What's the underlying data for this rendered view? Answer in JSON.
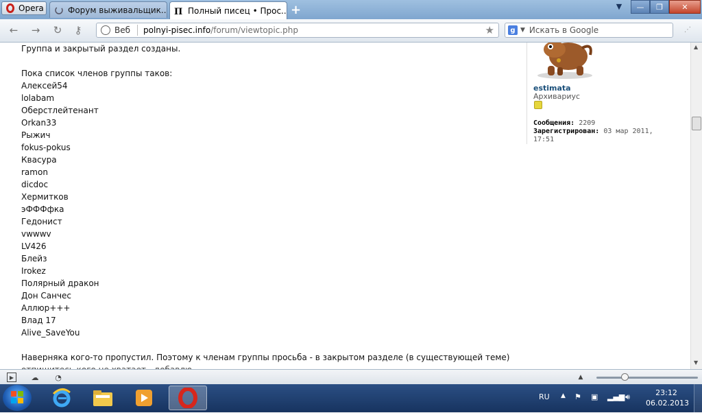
{
  "browser": {
    "menu_label": "Opera",
    "tabs": [
      {
        "label": "Форум выживальщик...",
        "active": false
      },
      {
        "label": "Полный писец • Прос...",
        "active": true
      }
    ],
    "new_tab_glyph": "+",
    "window_controls": {
      "minimize": "—",
      "maximize": "❐",
      "close": "✕"
    }
  },
  "toolbar": {
    "back_icon": "arrow-left-icon",
    "forward_icon": "arrow-right-icon",
    "reload_icon": "reload-icon",
    "wand_icon": "key-icon",
    "address": {
      "scope_label": "Веб",
      "host": "polnyi-pisec.info",
      "path": "/forum/viewtopic.php"
    },
    "search": {
      "engine_icon": "google-icon",
      "placeholder": "Искать в Google"
    }
  },
  "post": {
    "intro": "Группа и закрытый раздел созданы.",
    "list_heading": "Пока список членов группы таков:",
    "members": [
      "Алексей54",
      "lolabam",
      "Оберстлейтенант",
      "Orkan33",
      "Рыжич",
      "fokus-pokus",
      "Квасура",
      "ramon",
      "dicdoc",
      "Хермитков",
      "эФФФфка",
      "Гедонист",
      "vwwwv",
      "LV426",
      "Блейз",
      "Irokez",
      "Полярный дракон",
      "Дон Санчес",
      "Аллюр+++",
      "Влад 17",
      "Alive_SaveYou"
    ],
    "outro": "Наверняка кого-то пропустил. Поэтому к членам группы просьба - в закрытом разделе (в существующей теме)",
    "outro_cut": "отпишитесь кого не хватает - добавлю"
  },
  "profile": {
    "username": "estimata",
    "rank": "Архивариус",
    "posts_label": "Сообщения:",
    "posts_value": "2209",
    "registered_label": "Зарегистрирован:",
    "registered_value": "03 мар 2011,",
    "registered_time": "17:51"
  },
  "taskbar": {
    "language": "RU",
    "time": "23:12",
    "date": "06.02.2013"
  },
  "colors": {
    "username": "#1a4f7a",
    "opera_red": "#c8201a",
    "taskbar": "#1f3f70"
  }
}
